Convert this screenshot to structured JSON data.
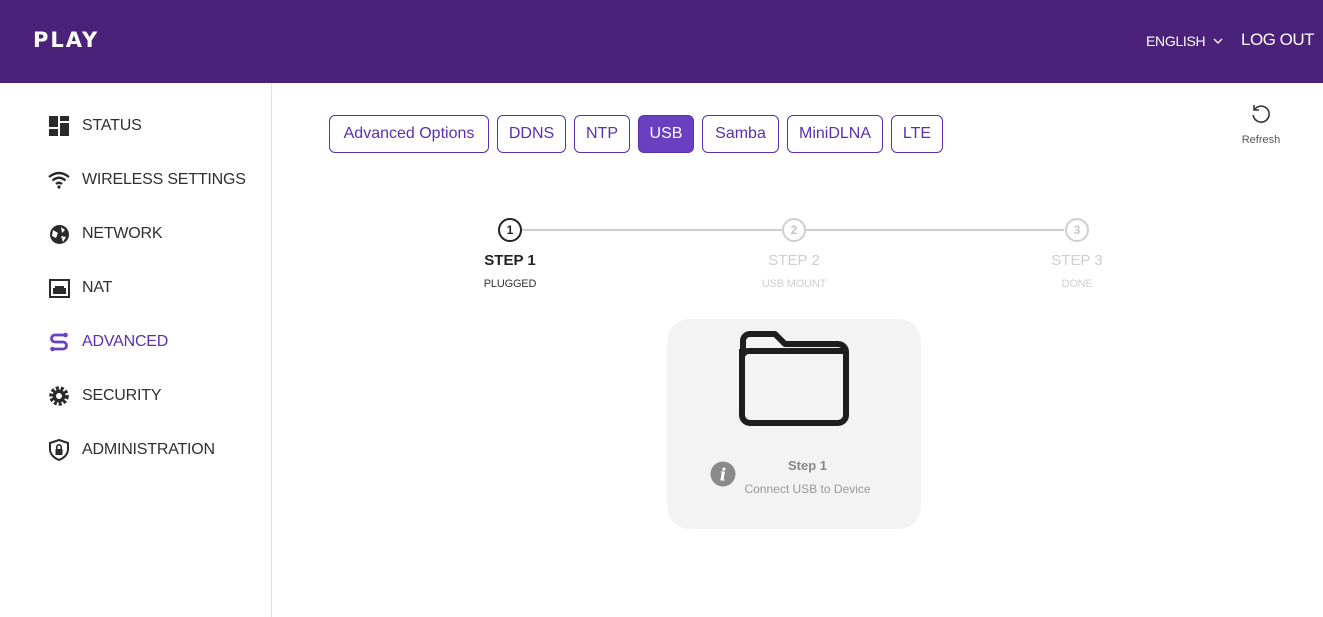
{
  "header": {
    "logo": "PLAY",
    "language": "ENGLISH",
    "logout": "LOG OUT"
  },
  "sidebar": {
    "items": [
      {
        "label": "STATUS",
        "icon": "dashboard-icon"
      },
      {
        "label": "WIRELESS SETTINGS",
        "icon": "wifi-icon"
      },
      {
        "label": "NETWORK",
        "icon": "globe-icon"
      },
      {
        "label": "NAT",
        "icon": "router-icon"
      },
      {
        "label": "ADVANCED",
        "icon": "advanced-icon",
        "active": true
      },
      {
        "label": "SECURITY",
        "icon": "gear-icon"
      },
      {
        "label": "ADMINISTRATION",
        "icon": "shield-lock-icon"
      }
    ]
  },
  "tabs": [
    {
      "label": "Advanced Options"
    },
    {
      "label": "DDNS"
    },
    {
      "label": "NTP"
    },
    {
      "label": "USB",
      "active": true
    },
    {
      "label": "Samba"
    },
    {
      "label": "MiniDLNA"
    },
    {
      "label": "LTE"
    }
  ],
  "refresh": {
    "label": "Refresh",
    "icon": "refresh-icon"
  },
  "stepper": {
    "steps": [
      {
        "number": "1",
        "title": "STEP 1",
        "subtitle": "PLUGGED",
        "active": true
      },
      {
        "number": "2",
        "title": "STEP 2",
        "subtitle": "USB MOUNT",
        "active": false
      },
      {
        "number": "3",
        "title": "STEP 3",
        "subtitle": "DONE",
        "active": false
      }
    ]
  },
  "card": {
    "icon": "folder-icon",
    "info_icon": "info-icon",
    "title": "Step 1",
    "subtitle": "Connect USB to Device"
  },
  "colors": {
    "brand": "#4a2279",
    "accent": "#6a3fc0",
    "inactive_step": "#cfcfcf"
  }
}
